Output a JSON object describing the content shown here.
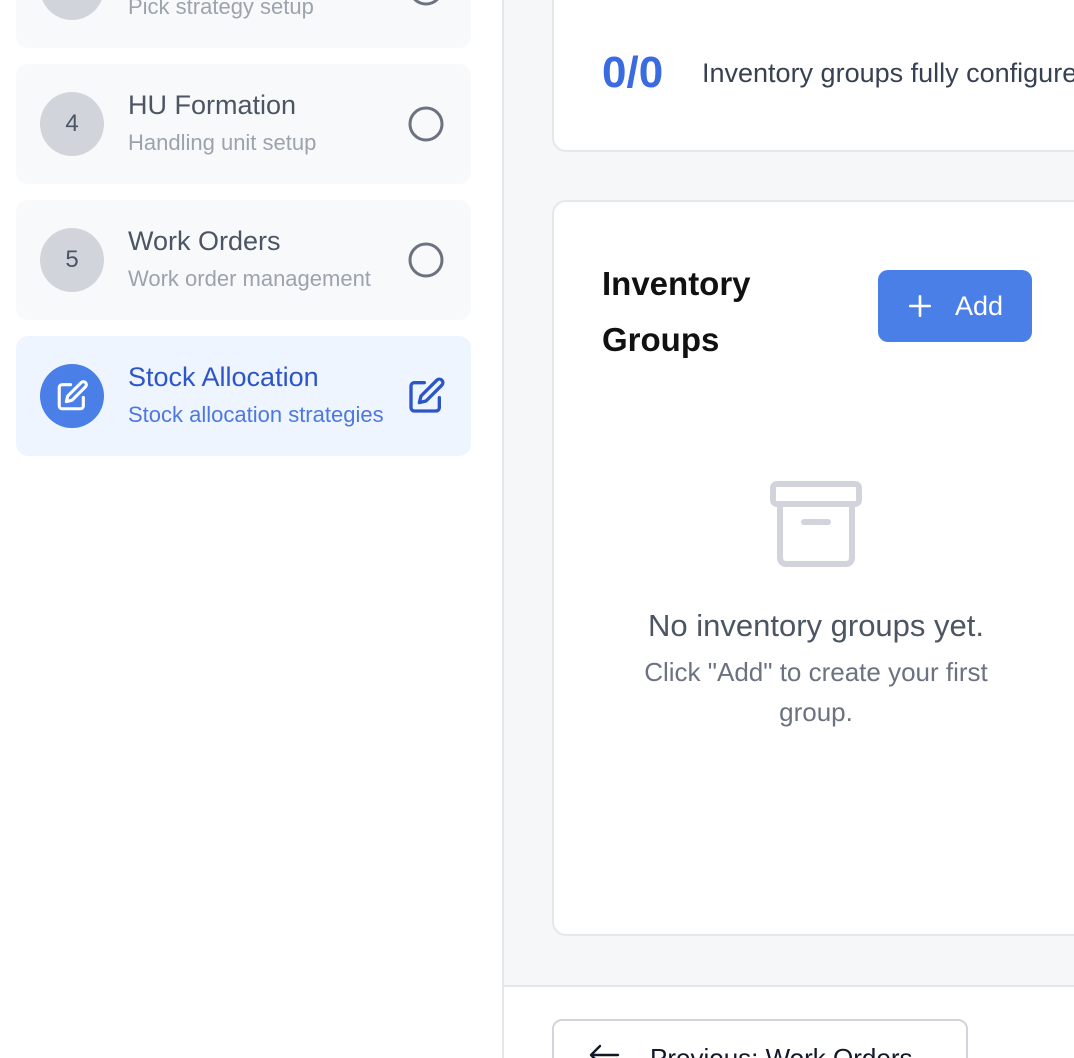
{
  "sidebar": {
    "steps": [
      {
        "number": "",
        "title": "",
        "subtitle": "Pick strategy setup",
        "status": "pending"
      },
      {
        "number": "4",
        "title": "HU Formation",
        "subtitle": "Handling unit setup",
        "status": "pending"
      },
      {
        "number": "5",
        "title": "Work Orders",
        "subtitle": "Work order management",
        "status": "pending"
      },
      {
        "number": "",
        "title": "Stock Allocation",
        "subtitle": "Stock allocation strategies",
        "status": "active"
      }
    ]
  },
  "progress": {
    "count": "0/0",
    "label": "Inventory groups fully configured"
  },
  "groups": {
    "title": "Inventory Groups",
    "add_label": "Add",
    "empty_title": "No inventory groups yet.",
    "empty_hint": "Click \"Add\" to create your first group."
  },
  "footer": {
    "previous_label": "Previous: Work Orders"
  },
  "colors": {
    "accent": "#4a7fe8",
    "accent_text": "#2b55c9",
    "active_step_bg": "#eff5ff"
  },
  "icons": {
    "pending": "circle-outline-icon",
    "active": "edit-icon",
    "empty": "archive-icon",
    "add": "plus-icon",
    "previous": "arrow-left-icon"
  }
}
